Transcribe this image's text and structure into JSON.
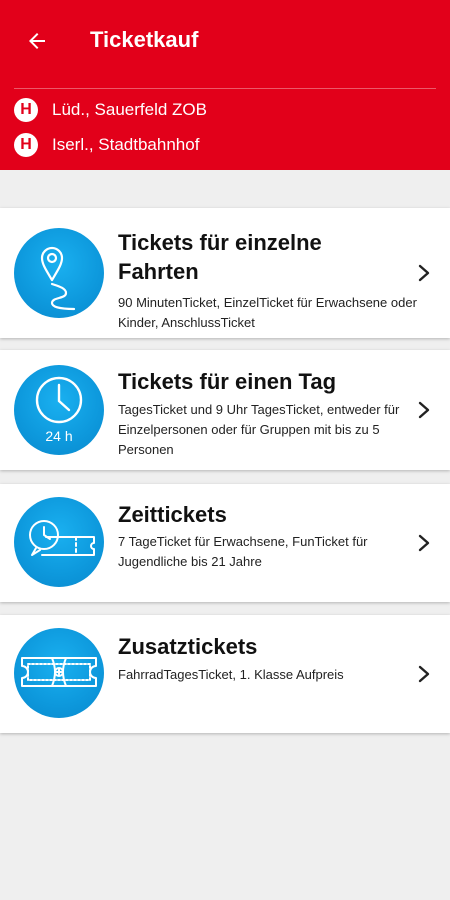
{
  "header": {
    "title": "Ticketkauf",
    "back_icon": "arrow-left-icon",
    "background_color": "#e2001a",
    "stops": [
      {
        "badge": "H",
        "name": "Lüd., Sauerfeld ZOB"
      },
      {
        "badge": "H",
        "name": "Iserl., Stadtbahnhof"
      }
    ]
  },
  "categories": [
    {
      "title": "Tickets für einzelne Fahrten",
      "description": "90 MinutenTicket, EinzelTicket für Erwachsene oder Kinder, AnschlussTicket",
      "icon": "route-pin-icon"
    },
    {
      "title": "Tickets für einen Tag",
      "description": "TagesTicket und 9 Uhr TagesTicket, entweder für Einzelpersonen oder für Gruppen mit bis zu 5 Personen",
      "icon": "clock-24h-icon",
      "icon_text": "24 h"
    },
    {
      "title": "Zeittickets",
      "description": "7 TageTicket für Erwachsene, FunTicket für Jugendliche bis 21 Jahre",
      "icon": "clock-ticket-icon"
    },
    {
      "title": "Zusatztickets",
      "description": "FahrradTagesTicket, 1. Klasse Aufpreis",
      "icon": "ticket-plus-icon"
    }
  ],
  "accent_color": "#0d98dc"
}
